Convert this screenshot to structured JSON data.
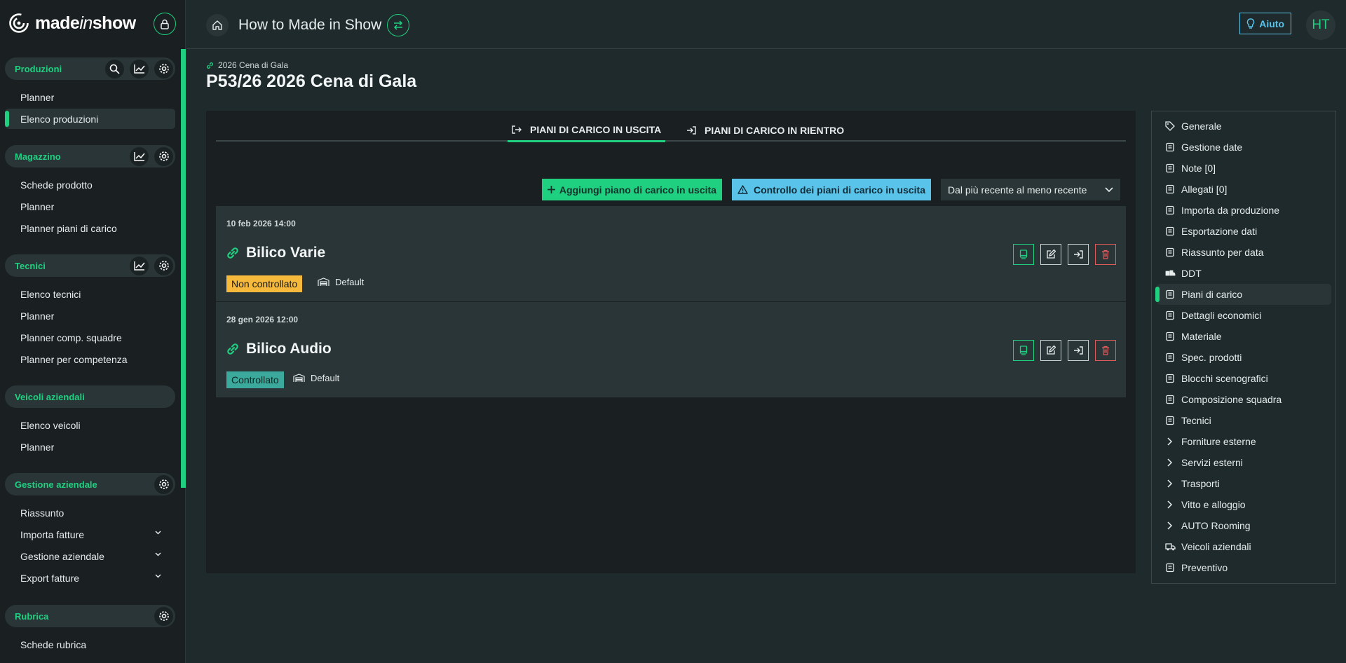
{
  "brand": {
    "name_bold": "made",
    "name_italic": "in",
    "name_tail": "show"
  },
  "sidebar": {
    "sections": [
      {
        "label": "Produzioni",
        "items": [
          "Planner",
          "Elenco produzioni"
        ]
      },
      {
        "label": "Magazzino",
        "items": [
          "Schede prodotto",
          "Planner",
          "Planner piani di carico"
        ]
      },
      {
        "label": "Tecnici",
        "items": [
          "Elenco tecnici",
          "Planner",
          "Planner comp. squadre",
          "Planner per competenza"
        ]
      },
      {
        "label": "Veicoli aziendali",
        "items": [
          "Elenco veicoli",
          "Planner"
        ]
      },
      {
        "label": "Gestione aziendale",
        "items": [
          "Riassunto",
          "Importa fatture",
          "Gestione aziendale",
          "Export fatture"
        ]
      },
      {
        "label": "Rubrica",
        "items": [
          "Schede rubrica"
        ]
      }
    ],
    "active_item": "Elenco produzioni"
  },
  "header": {
    "title": "How to Made in Show",
    "help_label": "Aiuto",
    "avatar_initials": "HT"
  },
  "page": {
    "breadcrumb": "2026 Cena di Gala",
    "title": "P53/26 2026 Cena di Gala"
  },
  "tabs": [
    {
      "label": "PIANI DI CARICO IN USCITA",
      "active": true
    },
    {
      "label": "PIANI DI CARICO IN RIENTRO",
      "active": false
    }
  ],
  "toolbar": {
    "add_label": "Aggiungi piano di carico in uscita",
    "check_label": "Controllo dei piani di carico in uscita",
    "sort_value": "Dal più recente al meno recente"
  },
  "cards": [
    {
      "date": "10 feb 2026 14:00",
      "name": "Bilico Varie",
      "status": "Non controllato",
      "template": "Default"
    },
    {
      "date": "28 gen 2026 12:00",
      "name": "Bilico Audio",
      "status": "Controllato",
      "template": "Default"
    }
  ],
  "right_nav": [
    {
      "label": "Generale",
      "icon": "tag-icon"
    },
    {
      "label": "Gestione date",
      "icon": "calendar-icon"
    },
    {
      "label": "Note [0]",
      "icon": "note-icon"
    },
    {
      "label": "Allegati [0]",
      "icon": "paperclip-icon"
    },
    {
      "label": "Importa da produzione",
      "icon": "file-import-icon"
    },
    {
      "label": "Esportazione dati",
      "icon": "file-export-icon"
    },
    {
      "label": "Riassunto per data",
      "icon": "calendar-check-icon"
    },
    {
      "label": "DDT",
      "icon": "truck-loading-icon"
    },
    {
      "label": "Piani di carico",
      "icon": "load-plan-icon"
    },
    {
      "label": "Dettagli economici",
      "icon": "money-bag-icon"
    },
    {
      "label": "Materiale",
      "icon": "boxes-icon"
    },
    {
      "label": "Spec. prodotti",
      "icon": "file-spec-icon"
    },
    {
      "label": "Blocchi scenografici",
      "icon": "hammer-icon"
    },
    {
      "label": "Composizione squadra",
      "icon": "team-icon"
    },
    {
      "label": "Tecnici",
      "icon": "worker-icon"
    },
    {
      "label": "Forniture esterne",
      "icon": "chevron-right-icon"
    },
    {
      "label": "Servizi esterni",
      "icon": "chevron-right-icon"
    },
    {
      "label": "Trasporti",
      "icon": "chevron-right-icon"
    },
    {
      "label": "Vitto e alloggio",
      "icon": "chevron-right-icon"
    },
    {
      "label": "AUTO Rooming",
      "icon": "chevron-right-icon"
    },
    {
      "label": "Veicoli aziendali",
      "icon": "truck-icon"
    },
    {
      "label": "Preventivo",
      "icon": "invoice-icon"
    }
  ],
  "right_nav_active": "Piani di carico",
  "colors": {
    "accent": "#1fd080",
    "info": "#5ac3ea",
    "warning": "#f6b93b",
    "ok": "#3ba99c",
    "danger": "#e05a5a"
  }
}
